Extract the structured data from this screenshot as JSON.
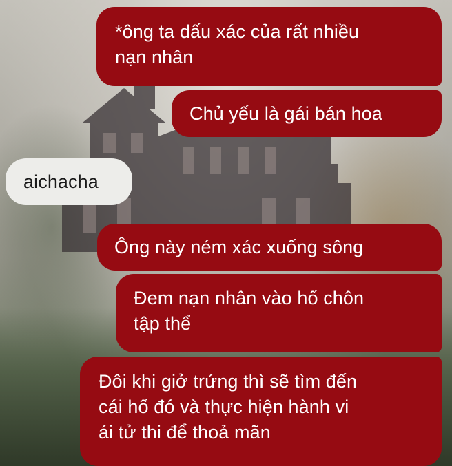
{
  "chat": {
    "messages": [
      {
        "direction": "outgoing",
        "lines": [
          "*ông ta dấu xác của rất nhiều",
          "nạn nhân"
        ]
      },
      {
        "direction": "outgoing",
        "lines": [
          "Chủ yếu là gái bán hoa"
        ]
      },
      {
        "direction": "incoming",
        "lines": [
          "aichacha"
        ]
      },
      {
        "direction": "outgoing",
        "lines": [
          "Ông này ném xác xuống sông"
        ]
      },
      {
        "direction": "outgoing",
        "lines": [
          "Đem nạn nhân vào hố chôn",
          "tập thể"
        ]
      },
      {
        "direction": "outgoing",
        "lines": [
          "Đôi khi giở trứng thì sẽ tìm đến",
          "cái hố đó và thực hiện hành vi",
          "ái tử thi để thoả mãn"
        ]
      }
    ]
  },
  "colors": {
    "outgoing_bubble": "#960b12",
    "incoming_bubble": "#ededea",
    "outgoing_text": "#ffffff",
    "incoming_text": "#1a1a1a"
  },
  "background": {
    "icon": "haunted-house-wallpaper"
  }
}
